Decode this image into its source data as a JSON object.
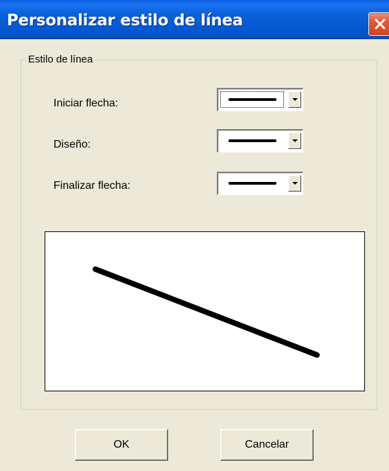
{
  "window": {
    "title": "Personalizar estilo de línea",
    "close_icon": "close-x-icon"
  },
  "group": {
    "legend": "Estilo de línea"
  },
  "fields": [
    {
      "label": "Iniciar flecha:",
      "value_icon": "solid-line-icon",
      "focused": true
    },
    {
      "label": "Diseño:",
      "value_icon": "solid-line-icon",
      "focused": false
    },
    {
      "label": "Finalizar flecha:",
      "value_icon": "solid-line-icon",
      "focused": false
    }
  ],
  "preview": {
    "line_style": "solid",
    "line_color": "#000000"
  },
  "buttons": {
    "ok": "OK",
    "cancel": "Cancelar"
  }
}
